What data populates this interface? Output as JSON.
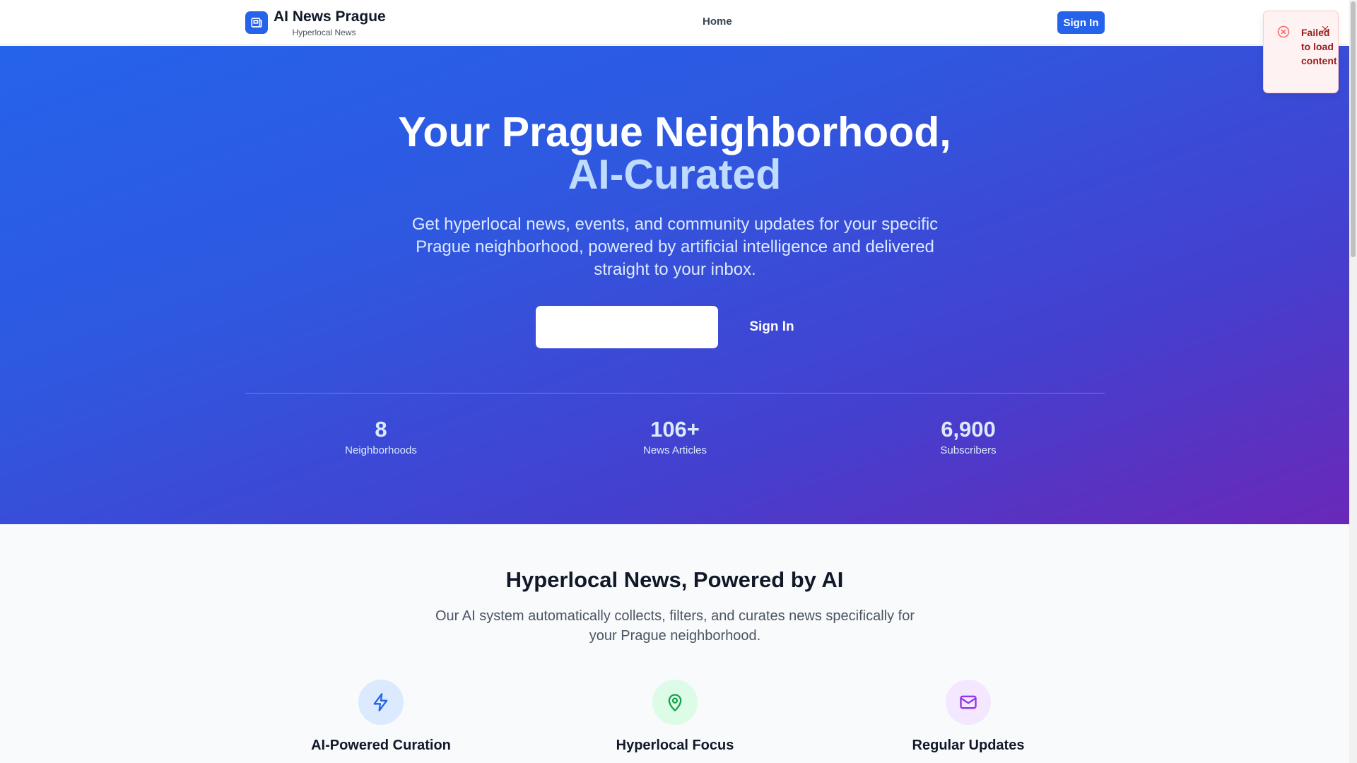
{
  "header": {
    "brand_name": "AI News Prague",
    "brand_sub": "Hyperlocal News",
    "nav_home": "Home",
    "signin_label": "Sign In",
    "logo_icon": "newspaper-icon"
  },
  "hero": {
    "title_line1": "Your Prague Neighborhood,",
    "title_line2": "AI-Curated",
    "description": "Get hyperlocal news, events, and community updates for your specific Prague neighborhood, powered by artificial intelligence and delivered straight to your inbox.",
    "cta_label": "",
    "signin_label": "Sign In",
    "stats": [
      {
        "value": "8",
        "label": "Neighborhoods"
      },
      {
        "value": "106+",
        "label": "News Articles"
      },
      {
        "value": "6,900",
        "label": "Subscribers"
      }
    ]
  },
  "features": {
    "title": "Hyperlocal News, Powered by AI",
    "description": "Our AI system automatically collects, filters, and curates news specifically for your Prague neighborhood.",
    "items": [
      {
        "title": "AI-Powered Curation",
        "icon": "lightning-icon",
        "color": "#2563eb",
        "bg": "#dbeafe"
      },
      {
        "title": "Hyperlocal Focus",
        "icon": "map-pin-icon",
        "color": "#16a34a",
        "bg": "#dcfce7"
      },
      {
        "title": "Regular Updates",
        "icon": "mail-icon",
        "color": "#9333ea",
        "bg": "#f3e8ff"
      }
    ]
  },
  "toast": {
    "message": "Failed to load content",
    "icon": "error-circle-icon",
    "color": "#991b1b"
  },
  "colors": {
    "primary": "#2563eb",
    "hero_gradient_start": "#2563eb",
    "hero_gradient_end": "#6a28b8"
  }
}
